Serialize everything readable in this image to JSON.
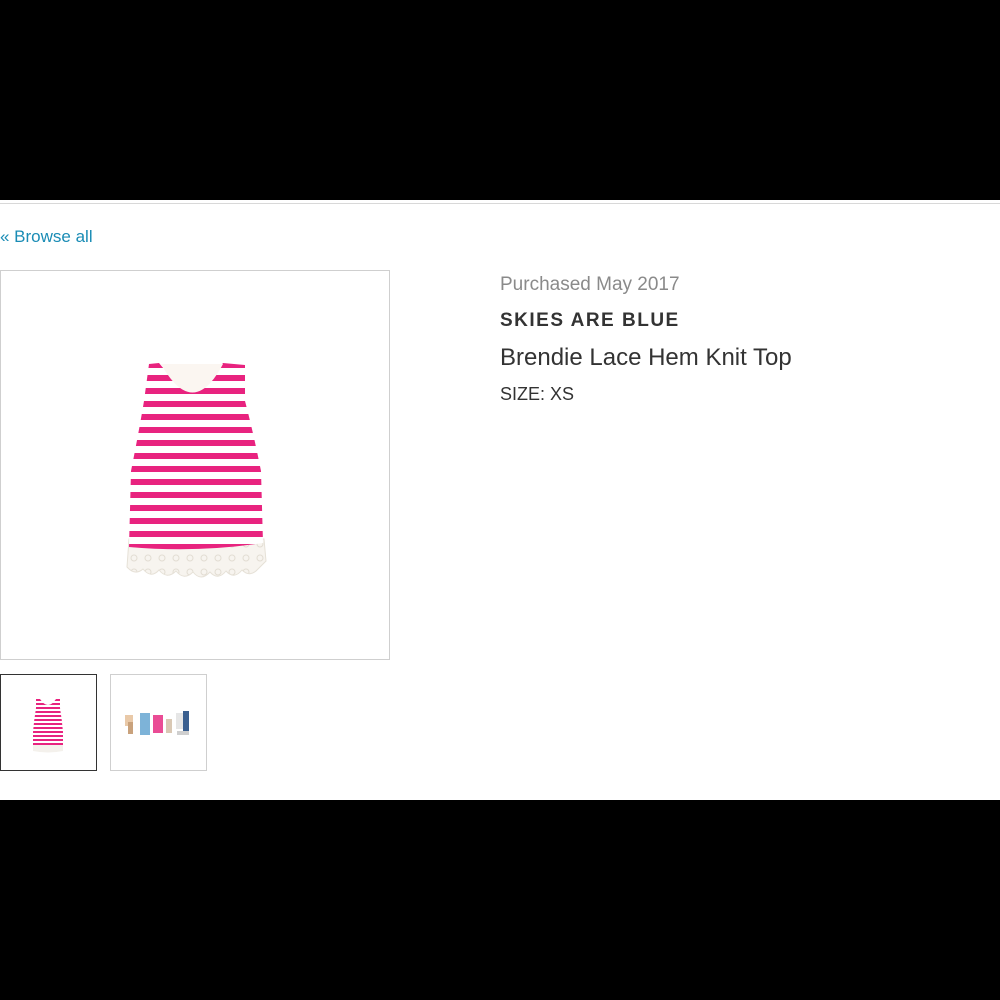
{
  "nav": {
    "back_label": "« Browse all"
  },
  "product": {
    "purchased": "Purchased May 2017",
    "brand": "SKIES ARE BLUE",
    "name": "Brendie Lace Hem Knit Top",
    "size": "SIZE: XS"
  },
  "gallery": {
    "selected_index": 0,
    "thumbnails": [
      "product-photo",
      "styled-outfit-photo"
    ]
  },
  "colors": {
    "link": "#1a8cb5",
    "stripe": "#e8237f",
    "lace": "#f4f1ec"
  }
}
